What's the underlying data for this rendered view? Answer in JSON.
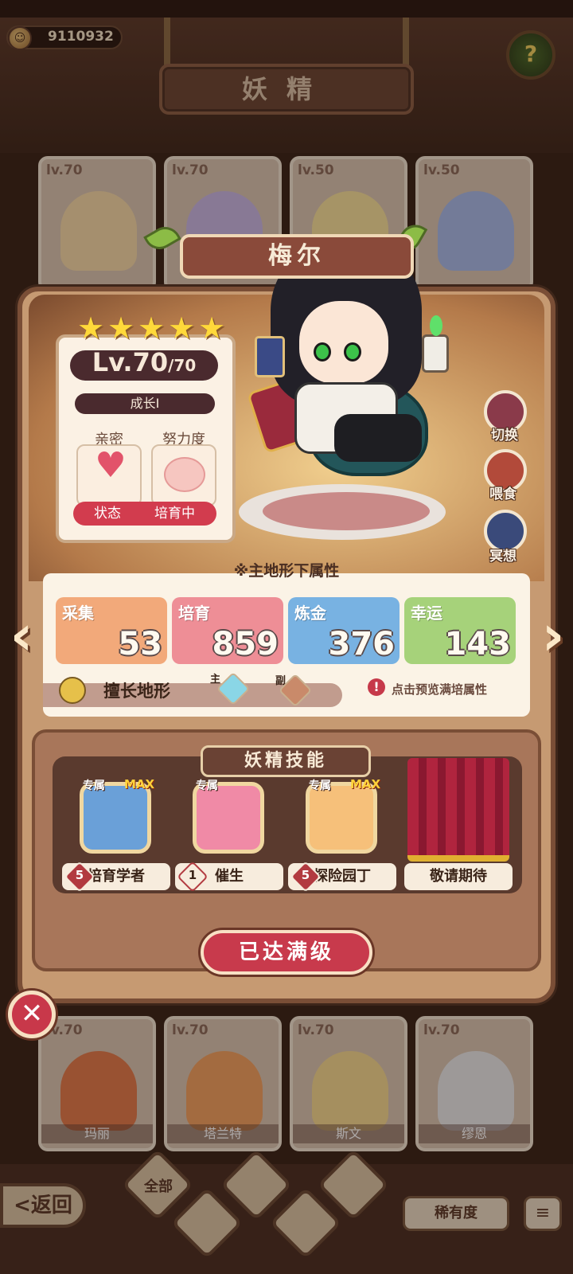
{
  "header": {
    "coins": "9110932",
    "title": "妖精",
    "help_icon": "question-flower-icon"
  },
  "background_cards_top": [
    {
      "level": "lv.70",
      "color": "#f3d8a6"
    },
    {
      "level": "lv.70",
      "color": "#c7b6e2"
    },
    {
      "level": "lv.50",
      "color": "#f5df9a"
    },
    {
      "level": "lv.50",
      "color": "#a6b8e6"
    }
  ],
  "background_cards_bottom": [
    {
      "level": "lv.70",
      "name": "玛丽",
      "color": "#e07a4a"
    },
    {
      "level": "lv.70",
      "name": "塔兰特",
      "color": "#f0a060"
    },
    {
      "level": "lv.70",
      "name": "斯文",
      "color": "#f3d890"
    },
    {
      "level": "lv.70",
      "name": "缪恩",
      "color": "#e6e6e6"
    }
  ],
  "bottom_nav": {
    "back_label": "<返回",
    "filter_all": "全部",
    "rarity_label": "稀有度",
    "sort_icon": "sort-icon"
  },
  "fairy": {
    "name": "梅尔",
    "stars": 5,
    "level": "Lv.70",
    "level_max": "/70",
    "growth": "成长I",
    "intimacy_label": "亲密",
    "effort_label": "努力度",
    "state_label": "状态",
    "state_value": "培育中"
  },
  "side_actions": [
    {
      "label": "切换",
      "icon": "switch-icon",
      "color": "#8a3a4a"
    },
    {
      "label": "喂食",
      "icon": "meat-icon",
      "color": "#b24a3a"
    },
    {
      "label": "冥想",
      "icon": "meditate-icon",
      "color": "#3a4a7a"
    }
  ],
  "attributes": {
    "header": "※主地形下属性",
    "items": [
      {
        "name": "采集",
        "value": "53",
        "color": "#f2a97a"
      },
      {
        "name": "培育",
        "value": "859",
        "color": "#ee8e96"
      },
      {
        "name": "炼金",
        "value": "376",
        "color": "#78b2e2"
      },
      {
        "name": "幸运",
        "value": "143",
        "color": "#a6d27a"
      }
    ],
    "terrain_label": "擅长地形",
    "main_tag": "主",
    "sub_tag": "副",
    "preview_hint": "点击预览满培属性"
  },
  "skills": {
    "title": "妖精技能",
    "items": [
      {
        "tag": "专属",
        "max": "MAX",
        "level": "5",
        "name": "培育学者",
        "color": "#6aa0d8"
      },
      {
        "tag": "专属",
        "max": "",
        "level": "1",
        "name": "催生",
        "color": "#f08aa6"
      },
      {
        "tag": "专属",
        "max": "MAX",
        "level": "5",
        "name": "探险园丁",
        "color": "#f6c07a"
      }
    ],
    "coming_soon": "敬请期待"
  },
  "max_button": "已达满级"
}
